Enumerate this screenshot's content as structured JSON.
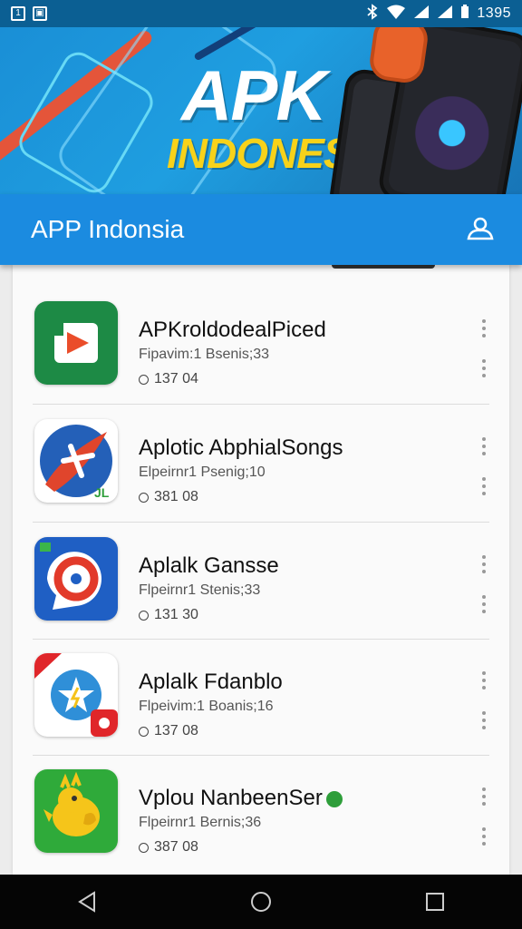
{
  "status_bar": {
    "left_icons": [
      "notification-icon",
      "gallery-icon"
    ],
    "right_icons": [
      "bluetooth-icon",
      "wifi-icon",
      "signal-icon",
      "signal-icon",
      "battery-icon"
    ],
    "time": "1395"
  },
  "hero": {
    "title": "APK",
    "subtitle": "INDONESIA"
  },
  "app_bar": {
    "title": "APP Indonsia",
    "account_icon": "account-icon"
  },
  "apps": [
    {
      "name": "APKroldodealPiced",
      "meta": "Fipavim:1 Bsenis;33",
      "stat": "137 04",
      "icon": "play-store-icon",
      "verified": false
    },
    {
      "name": "Aplotic AbphialSongs",
      "meta": "Elpeirnr1 Psenig;10",
      "stat": "381 08",
      "icon": "rocket-icon",
      "verified": false
    },
    {
      "name": "Aplalk Gansse",
      "meta": "Flpeirnr1 Stenis;33",
      "stat": "131 30",
      "icon": "chat-swirl-icon",
      "verified": false
    },
    {
      "name": "Aplalk Fdanblo",
      "meta": "Flpeivim:1 Boanis;16",
      "stat": "137 08",
      "icon": "star-icon",
      "verified": false
    },
    {
      "name": "Vplou NanbeenSer",
      "meta": "Flpeirnr1 Bernis;36",
      "stat": "387 08",
      "icon": "bird-icon",
      "verified": true
    }
  ],
  "nav": {
    "back": "back-icon",
    "home": "home-icon",
    "recents": "recents-icon"
  },
  "colors": {
    "app_bar": "#1b8be0",
    "status_bar": "#0b5f93",
    "hero_yellow": "#f7d21a"
  }
}
